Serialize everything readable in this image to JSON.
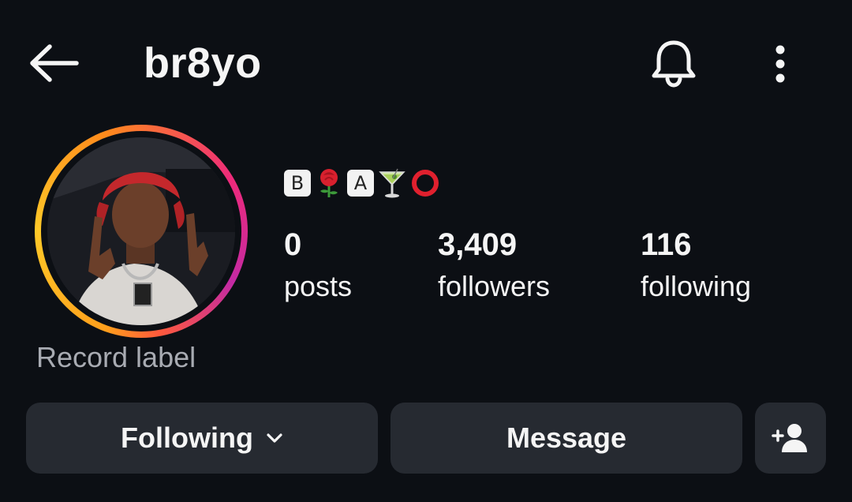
{
  "header": {
    "username": "br8yo",
    "back_icon": "arrow-left-icon",
    "bell_icon": "bell-icon",
    "more_icon": "more-vertical-icon"
  },
  "profile": {
    "category": "Record label",
    "bio_letters": [
      "B",
      "A"
    ],
    "bio_emoji_names": [
      "rose-emoji",
      "cocktail-glass-emoji",
      "hollow-red-circle-emoji"
    ]
  },
  "stats": {
    "posts": {
      "value": "0",
      "label": "posts"
    },
    "followers": {
      "value": "3,409",
      "label": "followers"
    },
    "following": {
      "value": "116",
      "label": "following"
    }
  },
  "actions": {
    "following_label": "Following",
    "message_label": "Message",
    "add_user_icon": "add-person-icon"
  },
  "colors": {
    "background": "#0c0f14",
    "button_bg": "#262a31",
    "text": "#f5f5f5",
    "muted_text": "#a8abb2",
    "ring_orange": "#ff9f1c",
    "ring_magenta": "#c32aa3"
  }
}
